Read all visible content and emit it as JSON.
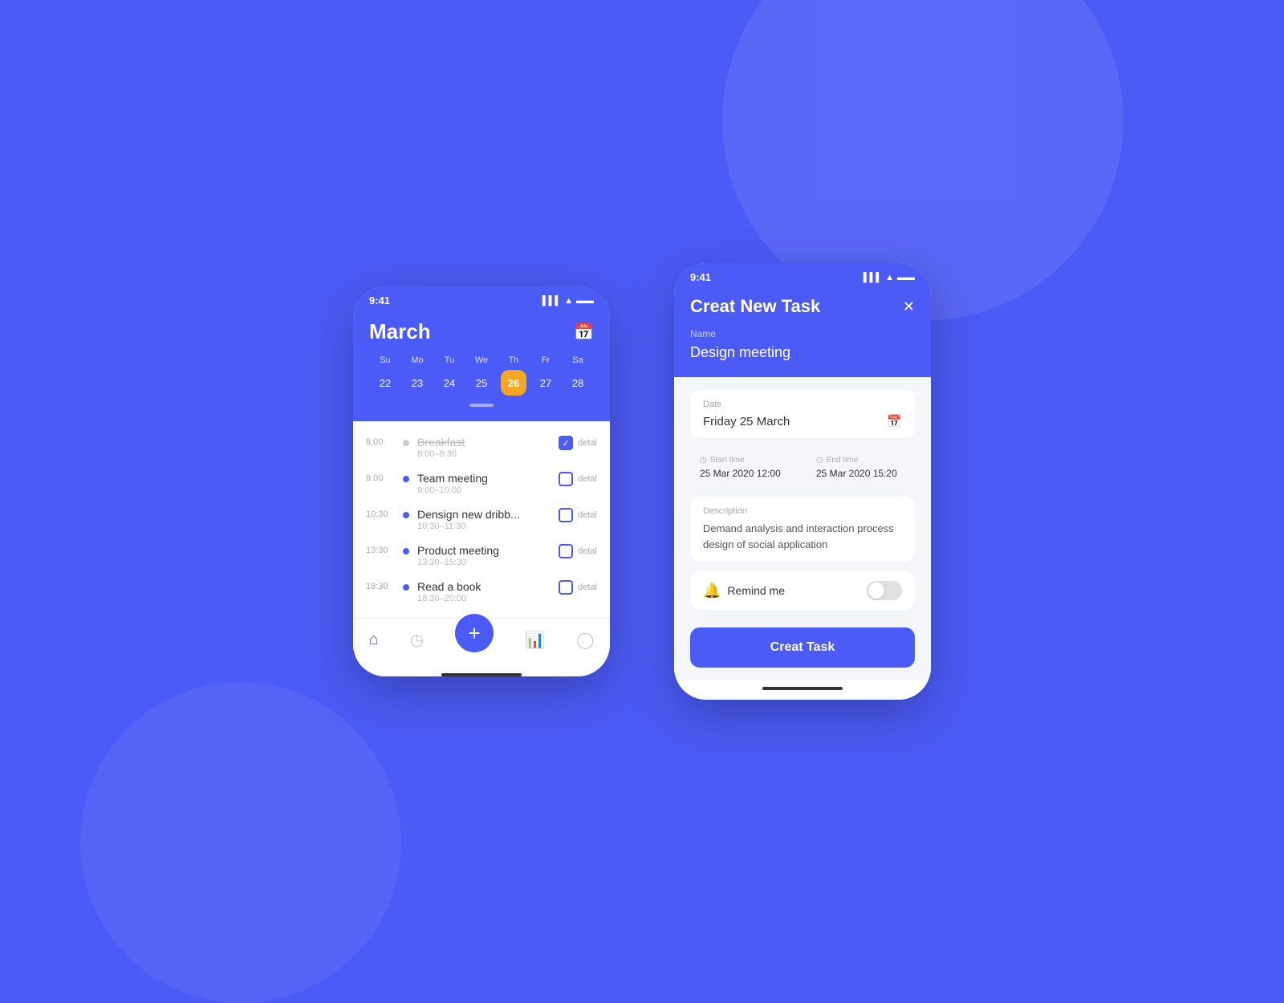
{
  "background": "#4B5BF5",
  "phone1": {
    "statusBar": {
      "time": "9:41",
      "icons": "▌▌▌ ▲ ▬▬▬"
    },
    "calendar": {
      "month": "March",
      "dayLabels": [
        "Su",
        "Mo",
        "Tu",
        "We",
        "Th",
        "Fr",
        "Sa"
      ],
      "dates": [
        "22",
        "23",
        "24",
        "25",
        "26",
        "27",
        "28"
      ],
      "activeDate": "26"
    },
    "tasks": [
      {
        "time": "8:00",
        "name": "Breakfast",
        "range": "8:00–8:30",
        "done": true,
        "checked": true,
        "dot": "gray"
      },
      {
        "time": "9:00",
        "name": "Team meeting",
        "range": "9:00–10:00",
        "done": false,
        "checked": false,
        "dot": "blue"
      },
      {
        "time": "10:30",
        "name": "Densign new dribb...",
        "range": "10:30–11:30",
        "done": false,
        "checked": false,
        "dot": "blue"
      },
      {
        "time": "13:30",
        "name": "Product meeting",
        "range": "13:30–15:30",
        "done": false,
        "checked": false,
        "dot": "blue"
      },
      {
        "time": "18:30",
        "name": "Read a book",
        "range": "18:30–20:00",
        "done": false,
        "checked": false,
        "dot": "blue"
      }
    ],
    "detalLabel": "detal",
    "nav": {
      "items": [
        "home",
        "clock",
        "plus",
        "chart",
        "user"
      ]
    }
  },
  "phone2": {
    "statusBar": {
      "time": "9:41",
      "icons": "▌▌▌ ▲ ▬▬▬"
    },
    "header": {
      "title": "Creat New Task",
      "closeBtn": "✕",
      "nameLabel": "Name",
      "nameValue": "Design meeting"
    },
    "form": {
      "dateLabel": "Date",
      "dateValue": "Friday 25 March",
      "startTimeLabel": "Start time",
      "startTimeValue": "25 Mar 2020  12:00",
      "endTimeLabel": "End time",
      "endTimeValue": "25 Mar 2020  15:20",
      "descriptionLabel": "Description",
      "descriptionValue": "Demand analysis and interaction process design of social application",
      "remindLabel": "Remind me",
      "createBtnLabel": "Creat Task"
    }
  }
}
